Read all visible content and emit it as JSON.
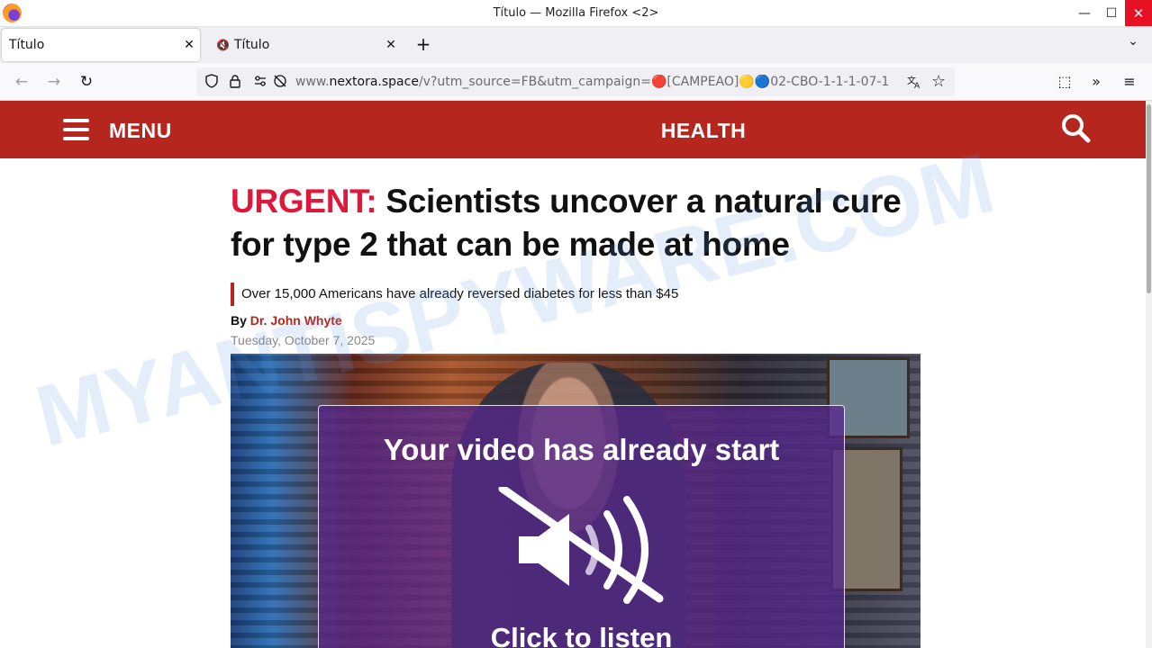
{
  "window": {
    "title": "Título — Mozilla Firefox <2>",
    "min_glyph": "—",
    "max_glyph": "☐",
    "close_glyph": "✕"
  },
  "tabs": [
    {
      "label": "Título",
      "active": true,
      "close": "✕"
    },
    {
      "label": "Título",
      "active": false,
      "close": "✕",
      "audio_icon": "🔇"
    }
  ],
  "tab_controls": {
    "new_tab": "+",
    "list_all": "⌄"
  },
  "nav": {
    "back": "←",
    "forward": "→",
    "reload": "↻",
    "url_prefix": "www.",
    "url_domain": "nextora.space",
    "url_rest": "/v?utm_source=FB&utm_campaign=🔴[CAMPEAO]🟡🔵02-CBO-1-1-1-07-1",
    "extensions": "⬚",
    "overflow": "»",
    "menu": "≡"
  },
  "site": {
    "menu_label": "MENU",
    "section": "HEALTH",
    "brand_color": "#b5261e",
    "urgent_color": "#e0173b"
  },
  "article": {
    "urgent": "URGENT:",
    "headline": " Scientists uncover a natural cure for type 2 that can be made at home",
    "subhead": "Over 15,000 Americans have already reversed diabetes for less than $45",
    "by": "By ",
    "author": "Dr. John Whyte",
    "date": "Tuesday, October 7, 2025"
  },
  "video_overlay": {
    "title": "Your video has already start",
    "cta": "Click to listen"
  },
  "watermark": "MYANTISPYWARE.COM"
}
